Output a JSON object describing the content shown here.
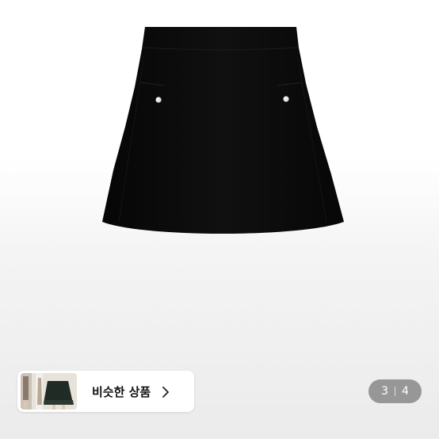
{
  "product": {
    "icon": "black-mini-skirt-photo"
  },
  "similar": {
    "label": "비슷한 상품",
    "thumbnail_icon": "similar-products-thumbnail",
    "chevron_icon": "chevron-right-icon"
  },
  "pager": {
    "current": "3",
    "total": "4"
  }
}
